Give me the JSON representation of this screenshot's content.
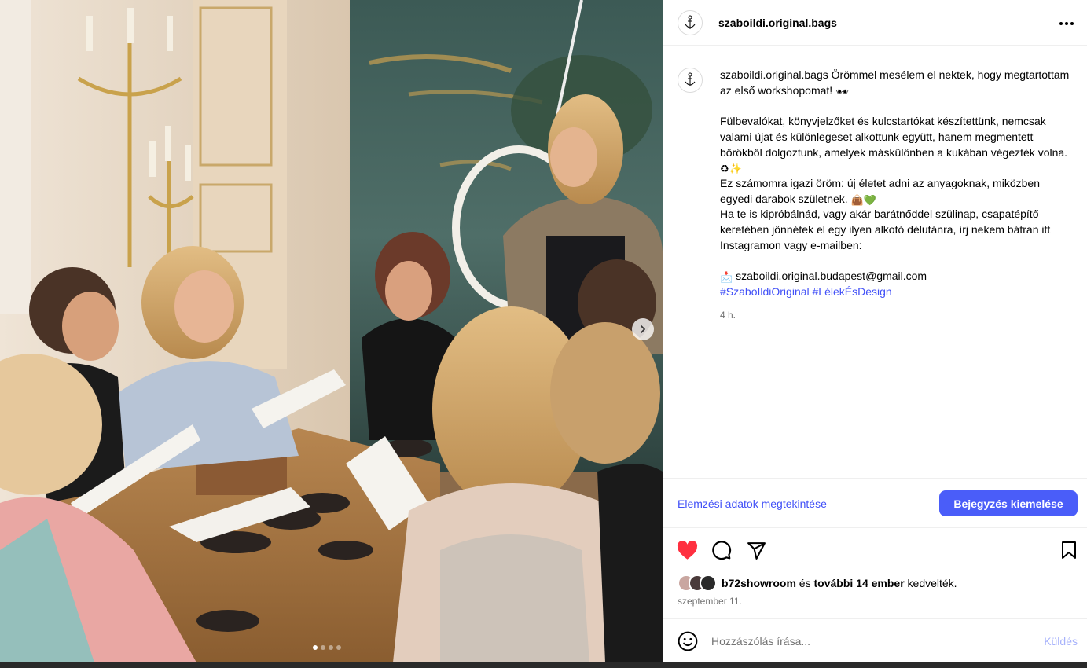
{
  "post": {
    "username": "szaboildi.original.bags",
    "caption": {
      "username": "szaboildi.original.bags",
      "intro": " Örömmel mesélem el nektek, hogy megtartottam az első workshopomat! ",
      "intro_emoji": "🕶",
      "paragraph_1": "Fülbevalókat, könyvjelzőket és kulcstartókat készítettünk, nemcsak valami újat és különlegeset alkottunk együtt, hanem megmentett bőrökből dolgoztunk, amelyek máskülönben a kukában végezték volna. ",
      "paragraph_1_emoji": "♻✨",
      "paragraph_2": "Ez számomra igazi öröm: új életet adni az anyagoknak, miközben egyedi darabok születnek. ",
      "paragraph_2_emoji": "👜💚",
      "paragraph_3": "Ha te is kipróbálnád, vagy akár barátnőddel szülinap, csapatépítő keretében jönnétek el egy ilyen alkotó délutánra, írj nekem bátran itt Instagramon vagy e-mailben:",
      "email_emoji": "📩",
      "email": " szaboildi.original.budapest@gmail.com",
      "hashtags": [
        "#SzaboIldiOriginal",
        "#LélekÉsDesign"
      ],
      "time_ago": "4 h."
    },
    "insights_link": "Elemzési adatok megtekintése",
    "boost_button": "Bejegyzés kiemelése",
    "likes": {
      "first_liker": "b72showroom",
      "connector": " és ",
      "others": "további 14 ember",
      "suffix": " kedvelték."
    },
    "date": "szeptember 11.",
    "comment": {
      "placeholder": "Hozzászólás írása...",
      "send_label": "Küldés"
    },
    "carousel": {
      "slide_count": 4,
      "active_slide": 1
    }
  },
  "colors": {
    "link_blue": "#4150f7",
    "boost_button": "#4a5df9",
    "like_red": "#ff3040",
    "send_disabled": "#a7b2fb",
    "muted_text": "#737373"
  },
  "icons": [
    "logo-icon",
    "more-options-icon",
    "heart-filled-icon",
    "comment-icon",
    "share-icon",
    "bookmark-icon",
    "emoji-icon",
    "chevron-right-icon"
  ]
}
